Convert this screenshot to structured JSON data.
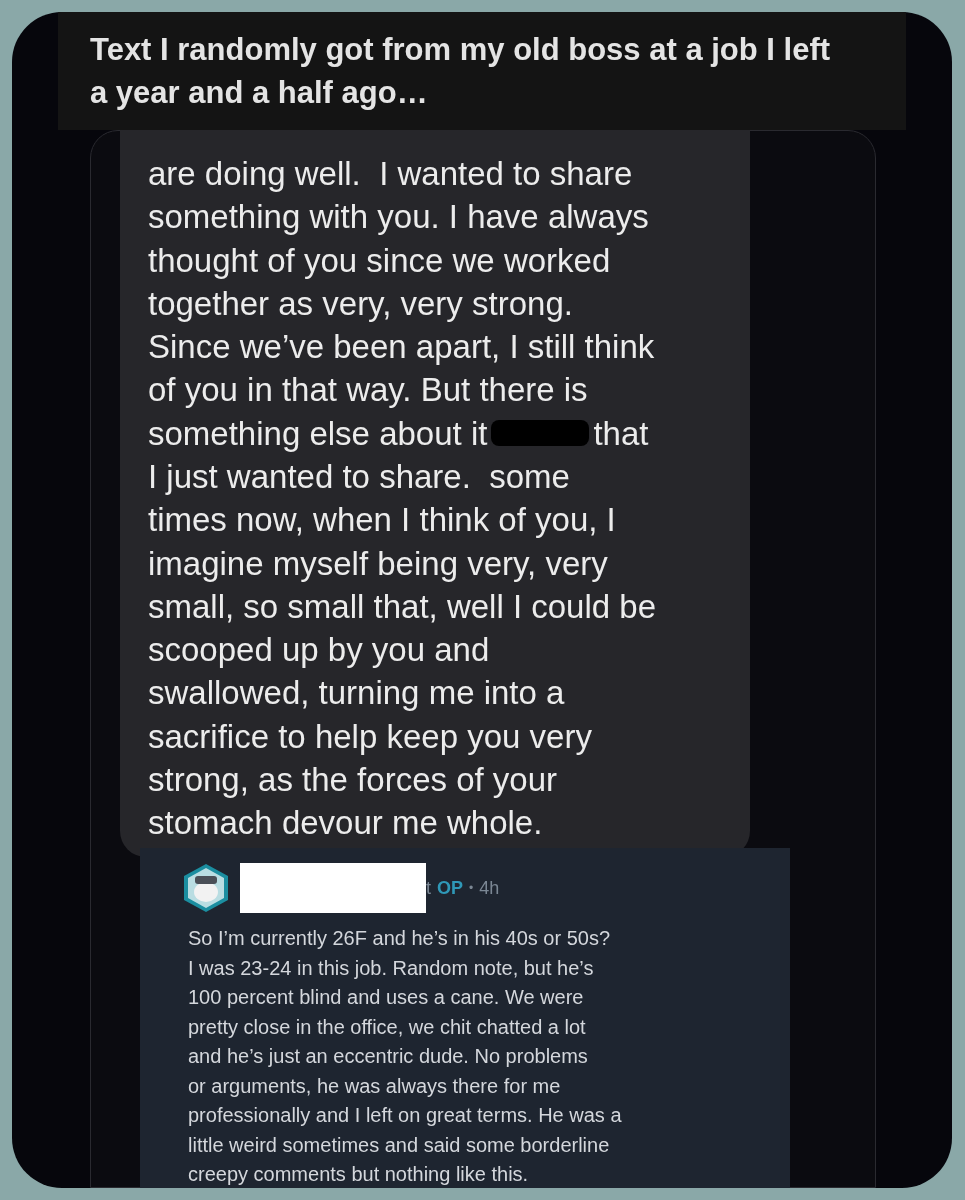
{
  "post": {
    "title": "Text I randomly got from my old boss at a job I left a year and a half ago…"
  },
  "message": {
    "lines": [
      {
        "kind": "plain",
        "segments": [
          "are doing well.  I wanted to share"
        ]
      },
      {
        "kind": "plain",
        "segments": [
          "something with you. I have always"
        ]
      },
      {
        "kind": "plain",
        "segments": [
          "thought of you since we worked"
        ]
      },
      {
        "kind": "plain",
        "segments": [
          "together as very, very strong."
        ]
      },
      {
        "kind": "plain",
        "segments": [
          "Since we’ve been apart, I still think"
        ]
      },
      {
        "kind": "plain",
        "segments": [
          "of you in that way. But there is"
        ]
      },
      {
        "kind": "redacted",
        "segments": [
          "something else about it",
          "that"
        ]
      },
      {
        "kind": "plain",
        "segments": [
          "I just wanted to share.  some"
        ]
      },
      {
        "kind": "plain",
        "segments": [
          "times now, when I think of you, I"
        ]
      },
      {
        "kind": "plain",
        "segments": [
          "imagine myself being very, very"
        ]
      },
      {
        "kind": "plain",
        "segments": [
          "small, so small that, well I could be"
        ]
      },
      {
        "kind": "plain",
        "segments": [
          "scooped up by you and"
        ]
      },
      {
        "kind": "plain",
        "segments": [
          "swallowed, turning me into a"
        ]
      },
      {
        "kind": "plain",
        "segments": [
          "sacrifice to help keep you very"
        ]
      },
      {
        "kind": "plain",
        "segments": [
          "strong, as the forces of your"
        ]
      },
      {
        "kind": "plain",
        "segments": [
          "stomach devour me whole."
        ]
      }
    ]
  },
  "comment": {
    "author_tail": "t",
    "badge": "OP",
    "separator": "•",
    "age": "4h",
    "lines": [
      "So I’m currently 26F and he’s in his 40s or 50s?",
      "I was 23-24 in this job. Random note, but he’s",
      "100 percent blind and uses a cane. We were",
      "pretty close in the office, we chit chatted a lot",
      "and he’s just an eccentric dude. No problems",
      "or arguments, he was always there for me",
      "professionally and I left on great terms. He was a",
      "little weird sometimes and said some borderline",
      "creepy comments but nothing like this."
    ]
  }
}
